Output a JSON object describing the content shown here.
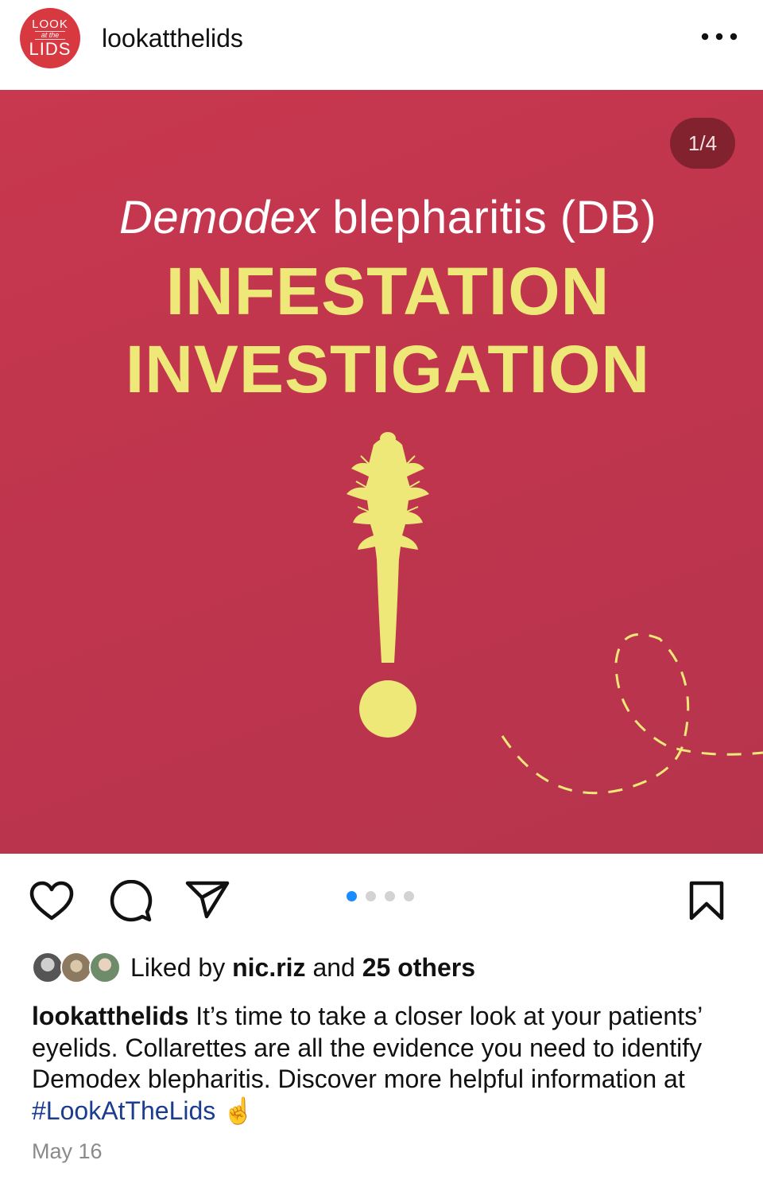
{
  "header": {
    "avatar": {
      "line1": "LOOK",
      "line2": "at the",
      "line3": "LIDS"
    },
    "username": "lookatthelids",
    "more_icon": "more-horizontal-icon"
  },
  "post": {
    "counter": "1/4",
    "subtitle_italic": "Demodex",
    "subtitle_rest": " blepharitis (DB)",
    "title_line1": "INFESTATION",
    "title_line2": "INVESTIGATION",
    "colors": {
      "background": "#c2364d",
      "accent": "#ede877"
    }
  },
  "actions": {
    "like_icon": "heart-icon",
    "comment_icon": "comment-icon",
    "share_icon": "paper-plane-icon",
    "save_icon": "bookmark-icon",
    "carousel_total": 4,
    "carousel_active": 1,
    "active_dot_color": "#1a8cff"
  },
  "likes": {
    "prefix": "Liked by ",
    "user": "nic.riz",
    "middle": " and ",
    "others": "25 others"
  },
  "caption": {
    "username": "lookatthelids",
    "text": " It’s time to take a closer look at your patients’ eyelids. Collarettes are all the evidence you need to identify Demodex blepharitis. Discover more helpful information at ",
    "hashtag": "#LookAtTheLids",
    "emoji": "☝️"
  },
  "date": "May 16"
}
